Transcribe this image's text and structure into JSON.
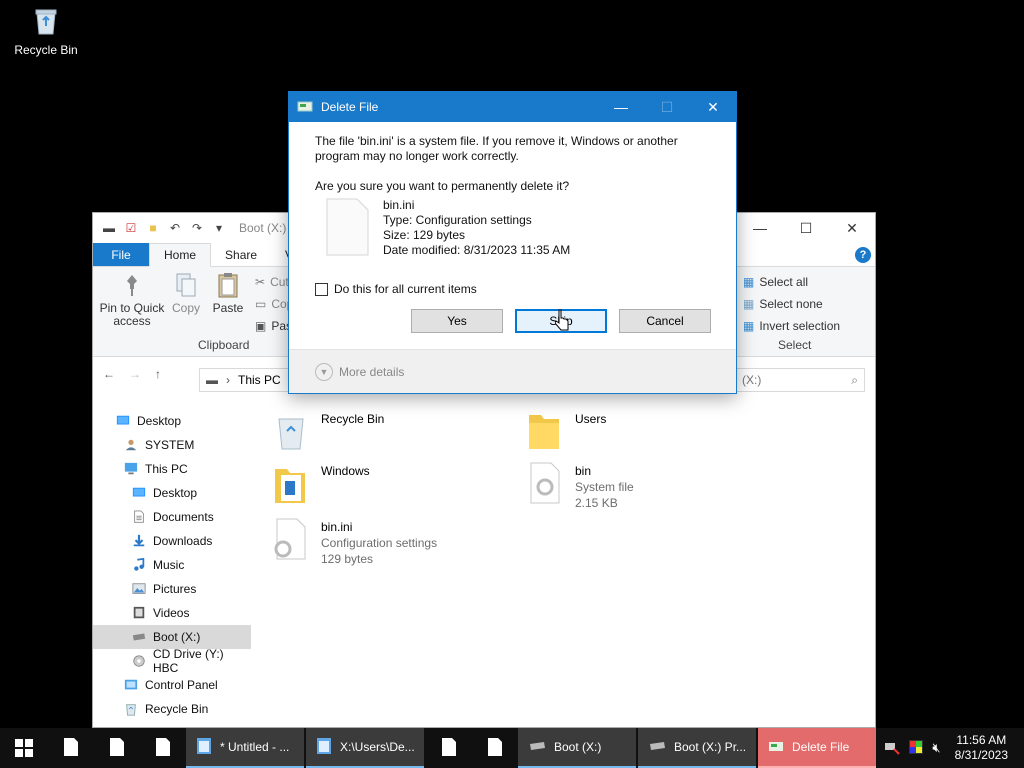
{
  "desktop": {
    "recycle_bin_label": "Recycle Bin"
  },
  "explorer": {
    "title": "Boot (X:)",
    "tabs": {
      "file": "File",
      "home": "Home",
      "share": "Share",
      "view": "Vi"
    },
    "clipboard": {
      "pin_label": "Pin to Quick access",
      "copy": "Copy",
      "paste": "Paste",
      "cut": "Cut",
      "copy_path": "Cop",
      "paste_shortcut": "Pas",
      "group": "Clipboard"
    },
    "select": {
      "select_all": "Select all",
      "select_none": "Select none",
      "invert": "Invert selection",
      "group": "Select"
    },
    "address": {
      "path": "This PC",
      "search_placeholder": "(X:)"
    },
    "nav": [
      {
        "label": "Desktop",
        "indent": 0
      },
      {
        "label": "SYSTEM",
        "indent": 1
      },
      {
        "label": "This PC",
        "indent": 1
      },
      {
        "label": "Desktop",
        "indent": 2
      },
      {
        "label": "Documents",
        "indent": 2
      },
      {
        "label": "Downloads",
        "indent": 2
      },
      {
        "label": "Music",
        "indent": 2
      },
      {
        "label": "Pictures",
        "indent": 2
      },
      {
        "label": "Videos",
        "indent": 2
      },
      {
        "label": "Boot (X:)",
        "indent": 2
      },
      {
        "label": "CD Drive (Y:) HBC",
        "indent": 2
      },
      {
        "label": "Control Panel",
        "indent": 1
      },
      {
        "label": "Recycle Bin",
        "indent": 1
      }
    ],
    "items": [
      {
        "name": "Recycle Bin",
        "sub1": "",
        "sub2": ""
      },
      {
        "name": "Users",
        "sub1": "",
        "sub2": ""
      },
      {
        "name": "Windows",
        "sub1": "",
        "sub2": ""
      },
      {
        "name": "bin",
        "sub1": "System file",
        "sub2": "2.15 KB"
      },
      {
        "name": "bin.ini",
        "sub1": "Configuration settings",
        "sub2": "129 bytes"
      }
    ]
  },
  "dialog": {
    "title": "Delete File",
    "warning": "The file 'bin.ini' is a system file. If you remove it, Windows or another program may no longer work correctly.",
    "question": "Are you sure you want to permanently delete it?",
    "file_name": "bin.ini",
    "file_type": "Type: Configuration settings",
    "file_size": "Size: 129 bytes",
    "file_date": "Date modified: 8/31/2023 11:35 AM",
    "checkbox_label": "Do this for all current items",
    "yes": "Yes",
    "skip": "Skip",
    "cancel": "Cancel",
    "more_details": "More details"
  },
  "taskbar": {
    "apps": [
      {
        "label": "* Untitled - ...",
        "active": false
      },
      {
        "label": "X:\\Users\\De...",
        "active": false
      },
      {
        "label": "Boot (X:)",
        "active": false
      },
      {
        "label": "Boot (X:) Pr...",
        "active": false
      },
      {
        "label": "Delete File",
        "active": true
      }
    ],
    "time": "11:56 AM",
    "date": "8/31/2023"
  },
  "colors": {
    "accent": "#1979ca",
    "taskbar": "#101010",
    "active_app": "#e36b6b"
  }
}
